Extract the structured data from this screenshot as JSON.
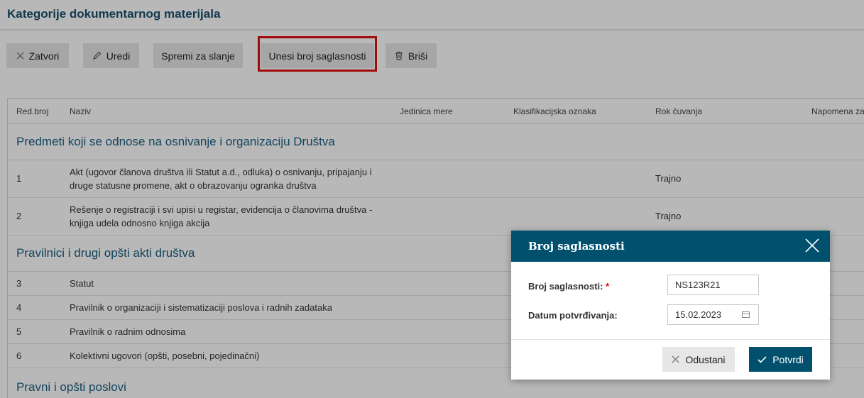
{
  "page": {
    "title": "Kategorije dokumentarnog materijala"
  },
  "toolbar": {
    "close": "Zatvori",
    "edit": "Uredi",
    "prepare": "Spremi za slanje",
    "consent": "Unesi broj saglasnosti",
    "delete": "Briši"
  },
  "table": {
    "columns": [
      "Red.broj",
      "Naziv",
      "Jedinica mere",
      "Klasifikacijska oznaka",
      "Rok čuvanja",
      "Napomena za"
    ],
    "groups": [
      {
        "title": "Predmeti koji se odnose na osnivanje i organizaciju Društva",
        "rows": [
          {
            "num": "1",
            "name": "Akt (ugovor članova društva ili Statut a.d., odluka) o osnivanju, pripajanju i druge statusne promene, akt o obrazovanju ogranka društva",
            "rok": "Trajno"
          },
          {
            "num": "2",
            "name": "Rešenje o registraciji i svi upisi u registar, evidencija o članovima društva - knjiga udela odnosno knjiga akcija",
            "rok": "Trajno"
          }
        ]
      },
      {
        "title": "Pravilnici i drugi opšti akti društva",
        "rows": [
          {
            "num": "3",
            "name": "Statut",
            "rok": ""
          },
          {
            "num": "4",
            "name": "Pravilnik o organizaciji i sistematizaciji poslova i radnih zadataka",
            "rok": ""
          },
          {
            "num": "5",
            "name": "Pravilnik o radnim odnosima",
            "rok": ""
          },
          {
            "num": "6",
            "name": "Kolektivni ugovori (opšti, posebni, pojedinačni)",
            "rok": ""
          }
        ]
      },
      {
        "title": "Pravni i opšti poslovi",
        "rows": []
      }
    ]
  },
  "modal": {
    "title": "Broj saglasnosti",
    "consent_label": "Broj saglasnosti:",
    "required_mark": "*",
    "consent_value": "NS123R21",
    "date_label": "Datum potvrđivanja:",
    "date_value": "15.02.2023",
    "cancel": "Odustani",
    "confirm": "Potvrdi"
  },
  "colors": {
    "accent": "#00506e",
    "link": "#1a5f82",
    "highlight": "#e01010",
    "required": "#dd0000"
  },
  "icons": [
    "close-icon",
    "pencil-icon",
    "trash-icon",
    "calendar-icon",
    "check-icon"
  ]
}
